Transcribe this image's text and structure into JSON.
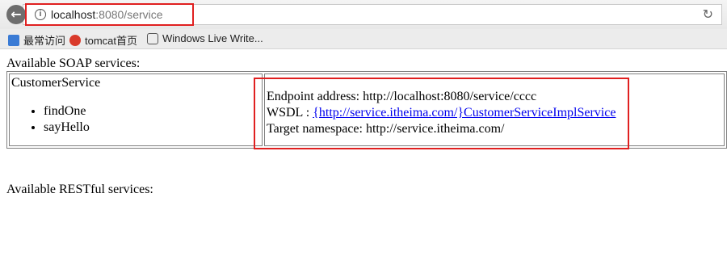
{
  "browser": {
    "url_host": "localhost",
    "url_rest": ":8080/service",
    "bookmarks": [
      {
        "label": "最常访问"
      },
      {
        "label": "tomcat首页"
      },
      {
        "label": "Windows Live Write..."
      }
    ]
  },
  "page": {
    "soap_title": "Available SOAP services:",
    "service": {
      "name": "CustomerService",
      "operations": [
        "findOne",
        "sayHello"
      ],
      "endpoint_label": "Endpoint address: http://localhost:8080/service/cccc",
      "wsdl_prefix": "WSDL : ",
      "wsdl_link": "{http://service.itheima.com/}CustomerServiceImplService",
      "namespace_label": "Target namespace: http://service.itheima.com/"
    },
    "rest_title": "Available RESTful services:"
  },
  "colors": {
    "highlight": "#e02020",
    "link": "#0000ee"
  }
}
